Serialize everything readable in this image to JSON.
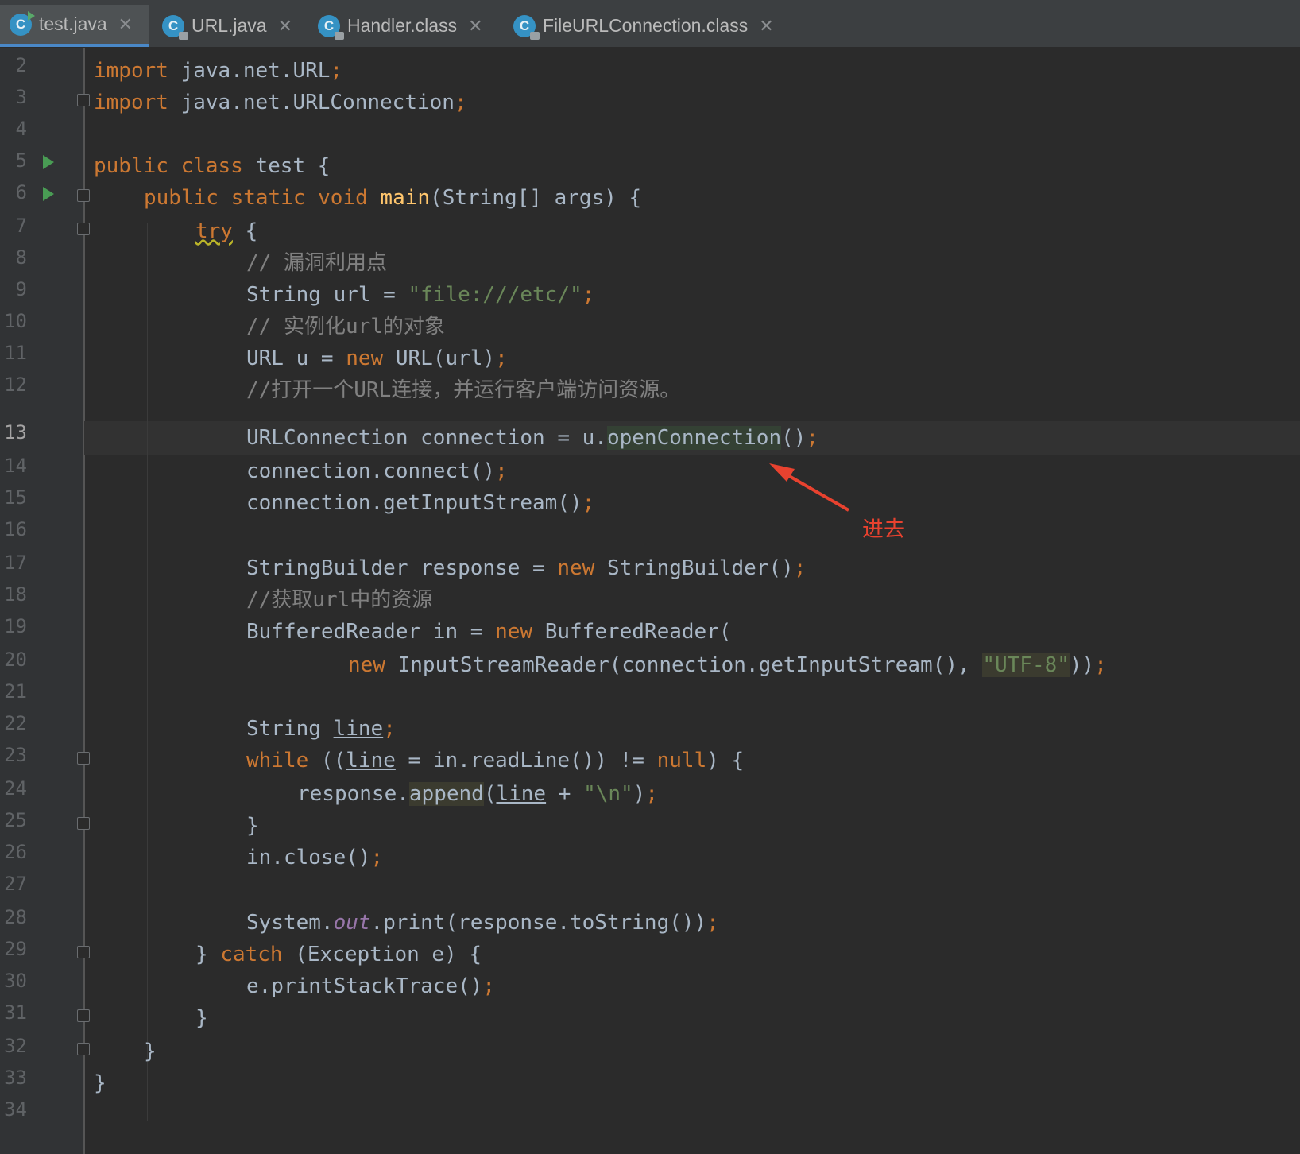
{
  "tabs": [
    {
      "label": "test.java"
    },
    {
      "label": "URL.java"
    },
    {
      "label": "Handler.class"
    },
    {
      "label": "FileURLConnection.class"
    }
  ],
  "line_numbers": [
    "2",
    "3",
    "4",
    "5",
    "6",
    "7",
    "8",
    "9",
    "10",
    "11",
    "12",
    "13",
    "14",
    "15",
    "16",
    "17",
    "18",
    "19",
    "20",
    "21",
    "22",
    "23",
    "24",
    "25",
    "26",
    "27",
    "28",
    "29",
    "30",
    "31",
    "32",
    "33",
    "34"
  ],
  "current_line": "13",
  "code": {
    "l2_kw": "import",
    "l2_rest": " java.net.URL",
    "l2_semi": ";",
    "l3_kw": "import",
    "l3_rest": " java.net.URLConnection",
    "l3_semi": ";",
    "l5_kw": "public class",
    "l5_rest": " test {",
    "l6_kw": "public static void",
    "l6_fn": " main",
    "l6_rest": "(String[] args) {",
    "l7_kw": "try",
    "l7_rest": " {",
    "l8_cmt": "// 漏洞利用点",
    "l9_a": "String url = ",
    "l9_str": "\"file:///etc/\"",
    "l9_semi": ";",
    "l10_cmt": "// 实例化url的对象",
    "l11_a": "URL u = ",
    "l11_kw": "new",
    "l11_b": " URL(url)",
    "l11_semi": ";",
    "l12_cmt": "//打开一个URL连接，并运行客户端访问资源。",
    "l13_a": "URLConnection connection = u.",
    "l13_hl": "openConnection",
    "l13_b": "()",
    "l13_semi": ";",
    "l14_a": "connection.connect()",
    "l14_semi": ";",
    "l15_a": "connection.getInputStream()",
    "l15_semi": ";",
    "l17_a": "StringBuilder response = ",
    "l17_kw": "new",
    "l17_b": " StringBuilder()",
    "l17_semi": ";",
    "l18_cmt": "//获取url中的资源",
    "l19_a": "BufferedReader in = ",
    "l19_kw": "new",
    "l19_b": " BufferedReader(",
    "l20_kw": "new",
    "l20_a": " InputStreamReader(connection.getInputStream(), ",
    "l20_str": "\"UTF-8\"",
    "l20_b": "))",
    "l20_semi": ";",
    "l22_a": "String ",
    "l22_var": "line",
    "l22_semi": ";",
    "l23_kw": "while",
    "l23_a": " ((",
    "l23_var": "line",
    "l23_b": " = in.readLine()) != ",
    "l23_kw2": "null",
    "l23_c": ") {",
    "l24_a": "response.",
    "l24_hl": "append",
    "l24_b": "(",
    "l24_var": "line",
    "l24_c": " + ",
    "l24_str": "\"\\n\"",
    "l24_d": ")",
    "l24_semi": ";",
    "l25_a": "}",
    "l26_a": "in.close()",
    "l26_semi": ";",
    "l28_a": "System.",
    "l28_static": "out",
    "l28_b": ".print(response.toString())",
    "l28_semi": ";",
    "l29_a": "} ",
    "l29_kw": "catch",
    "l29_b": " (Exception e) {",
    "l30_a": "e.printStackTrace()",
    "l30_semi": ";",
    "l31_a": "}",
    "l32_a": "}",
    "l33_a": "}"
  },
  "annotation": {
    "text": "进去",
    "color": "#e8422f"
  },
  "colors": {
    "keyword": "#cc7832",
    "string": "#6a8759",
    "comment": "#808080",
    "text": "#a9b7c6",
    "function": "#ffc66d",
    "background": "#2b2b2b"
  }
}
